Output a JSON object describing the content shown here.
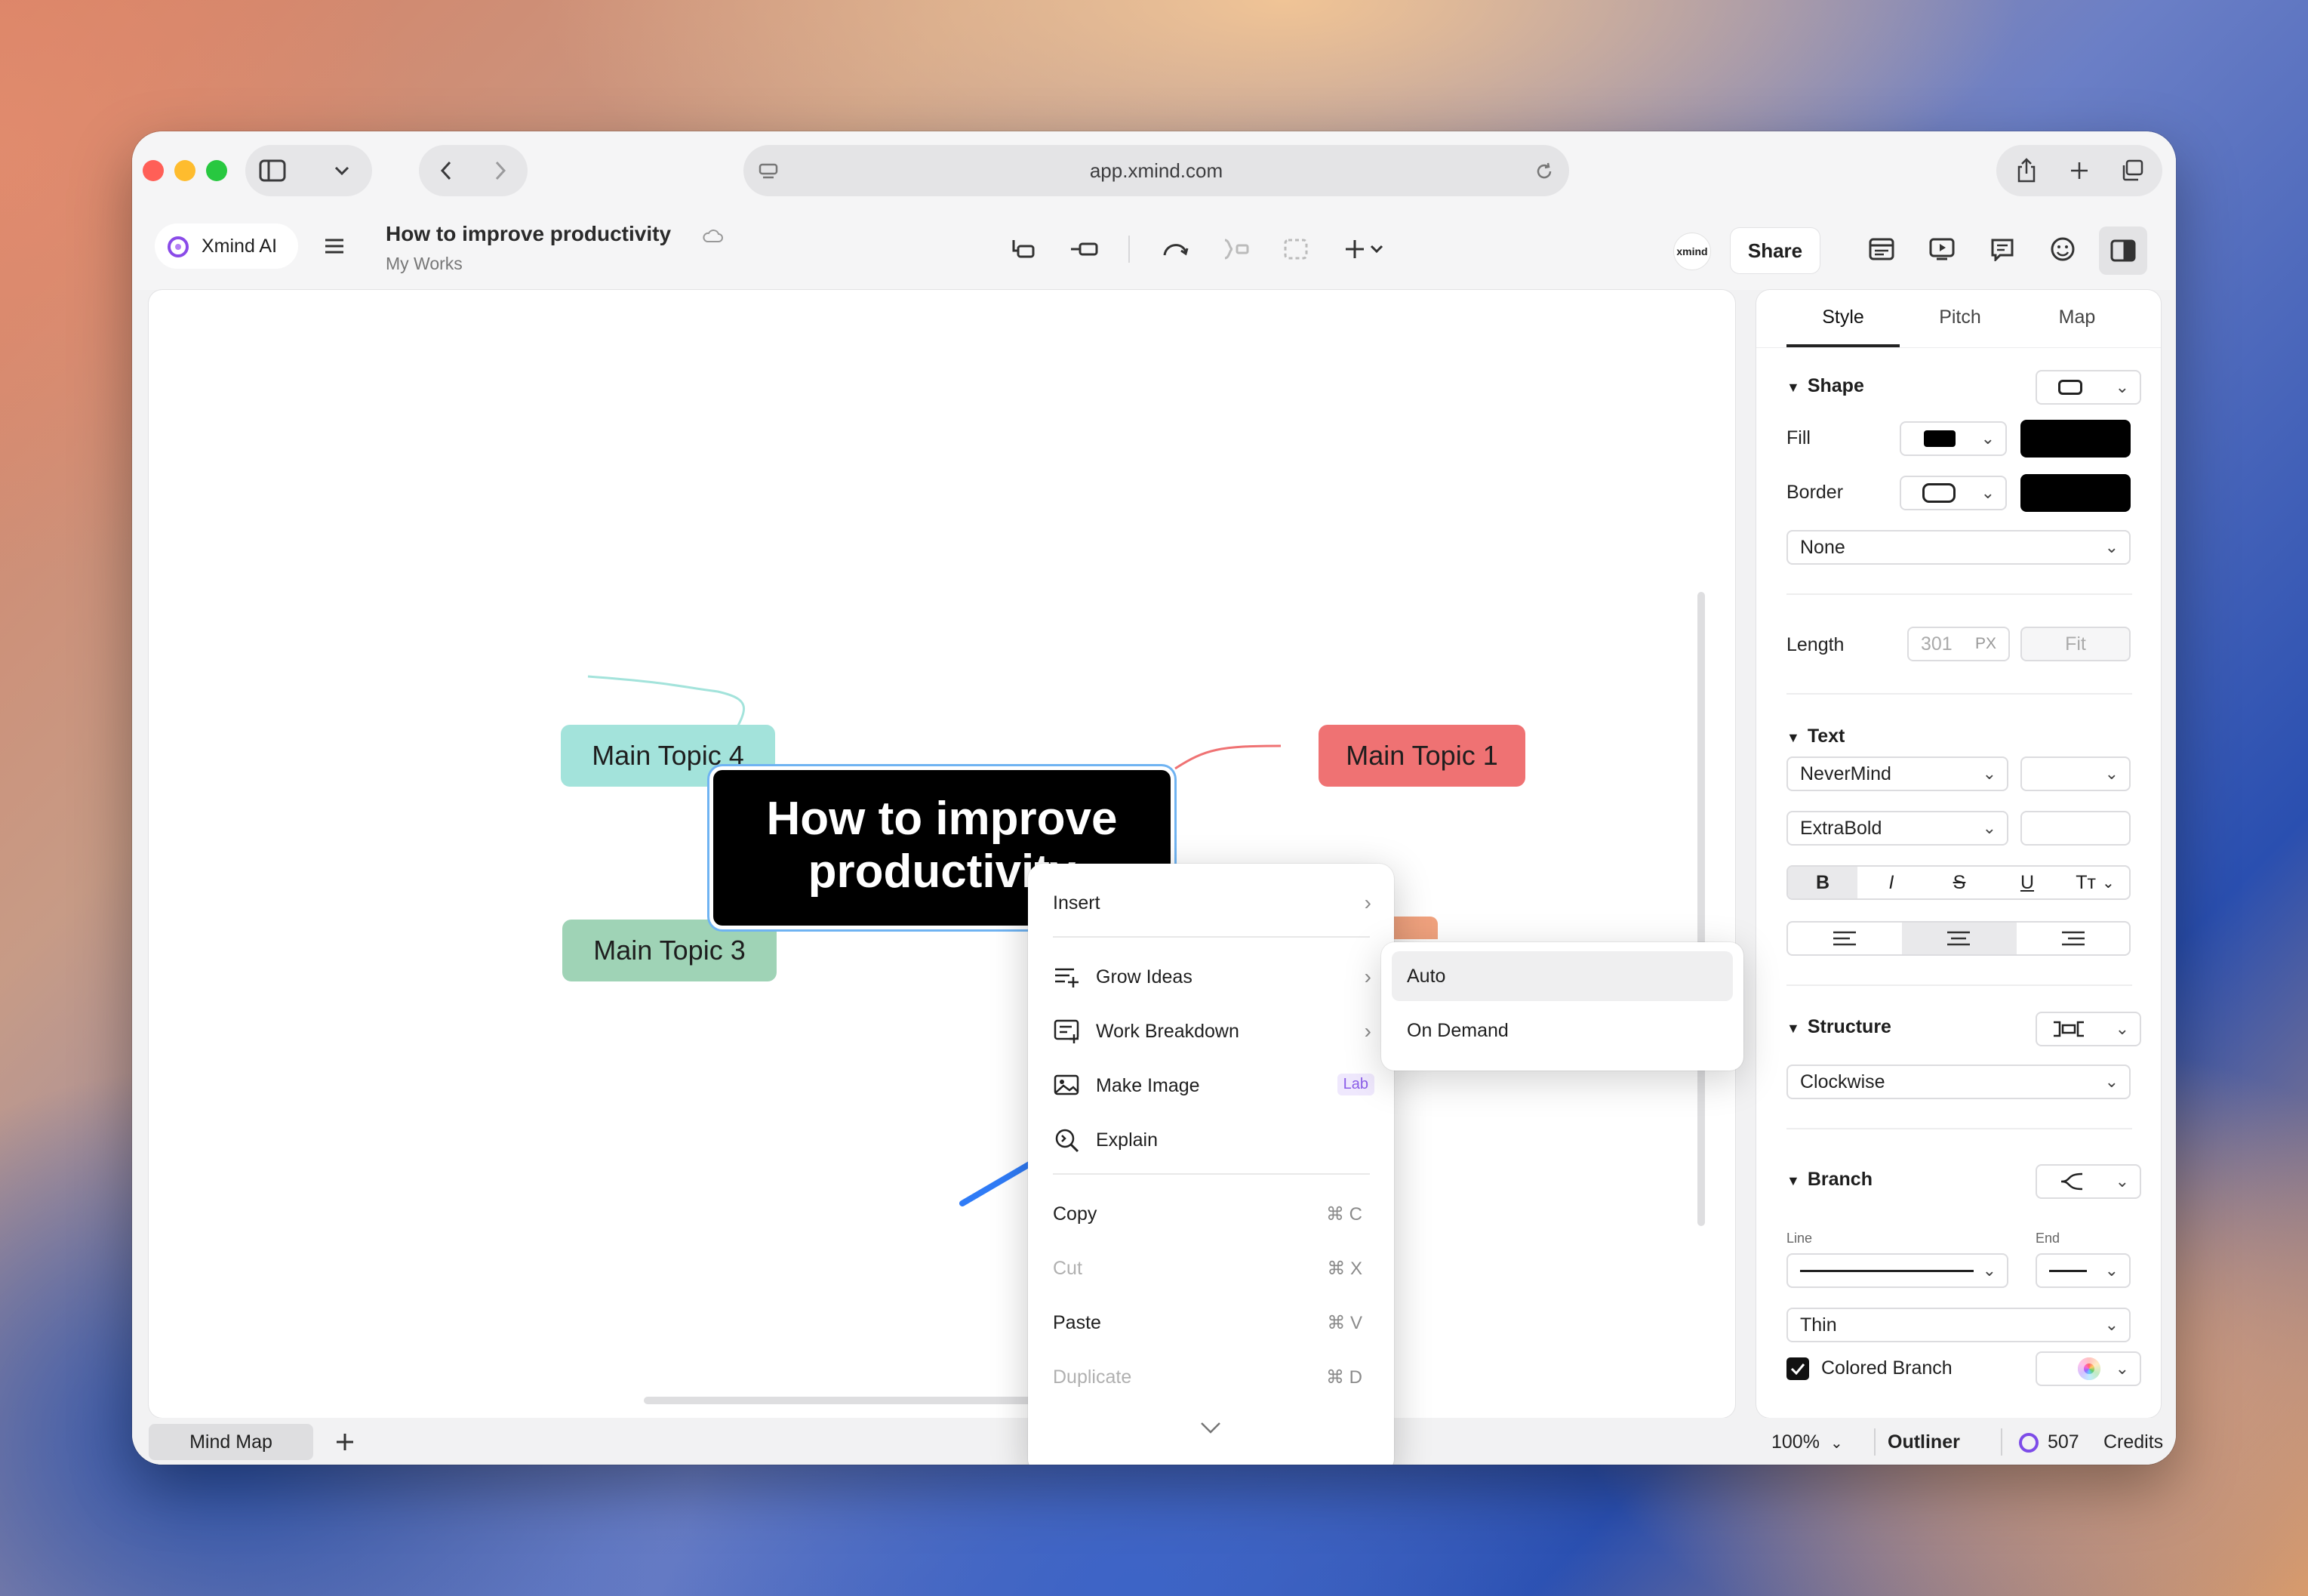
{
  "browser": {
    "url": "app.xmind.com"
  },
  "app": {
    "brand": "Xmind AI",
    "doc_title": "How to improve productivity",
    "doc_location": "My Works",
    "share_label": "Share",
    "avatar_text": "xmind"
  },
  "canvas": {
    "central_topic": "How to improve productivity",
    "topics": [
      "Main Topic 1",
      "Main Topic 3",
      "Main Topic 4"
    ]
  },
  "context_menu": {
    "items": [
      {
        "label": "Insert",
        "type": "submenu"
      },
      {
        "label": "Grow Ideas",
        "type": "submenu",
        "icon": "grow-ideas-icon"
      },
      {
        "label": "Work Breakdown",
        "type": "submenu",
        "icon": "work-breakdown-icon"
      },
      {
        "label": "Make Image",
        "badge": "Lab",
        "icon": "image-icon"
      },
      {
        "label": "Explain",
        "icon": "explain-icon"
      },
      {
        "label": "Copy",
        "shortcut": "⌘ C"
      },
      {
        "label": "Cut",
        "shortcut": "⌘ X",
        "disabled": true
      },
      {
        "label": "Paste",
        "shortcut": "⌘ V"
      },
      {
        "label": "Duplicate",
        "shortcut": "⌘ D",
        "disabled": true
      }
    ],
    "submenu": [
      "Auto",
      "On Demand"
    ]
  },
  "panel": {
    "tabs": [
      "Style",
      "Pitch",
      "Map"
    ],
    "active_tab": "Style",
    "shape": {
      "title": "Shape",
      "fill_label": "Fill",
      "border_label": "Border",
      "border_style": "None",
      "length_label": "Length",
      "length_value": "301",
      "length_unit": "PX",
      "fit_label": "Fit"
    },
    "text": {
      "title": "Text",
      "font": "NeverMind",
      "weight": "ExtraBold",
      "style_buttons": [
        "B",
        "I",
        "S",
        "U",
        "Tт"
      ]
    },
    "structure": {
      "title": "Structure",
      "value": "Clockwise"
    },
    "branch": {
      "title": "Branch",
      "line_label": "Line",
      "end_label": "End",
      "thickness": "Thin",
      "colored_label": "Colored Branch"
    }
  },
  "statusbar": {
    "sheet_tab": "Mind Map",
    "zoom": "100%",
    "outliner": "Outliner",
    "credits_count": "507",
    "credits_label": "Credits"
  },
  "colors": {
    "topic1": "#ef7273",
    "topic3": "#9fd3b6",
    "topic4": "#a3e3db",
    "accent": "#2f7bf6"
  }
}
